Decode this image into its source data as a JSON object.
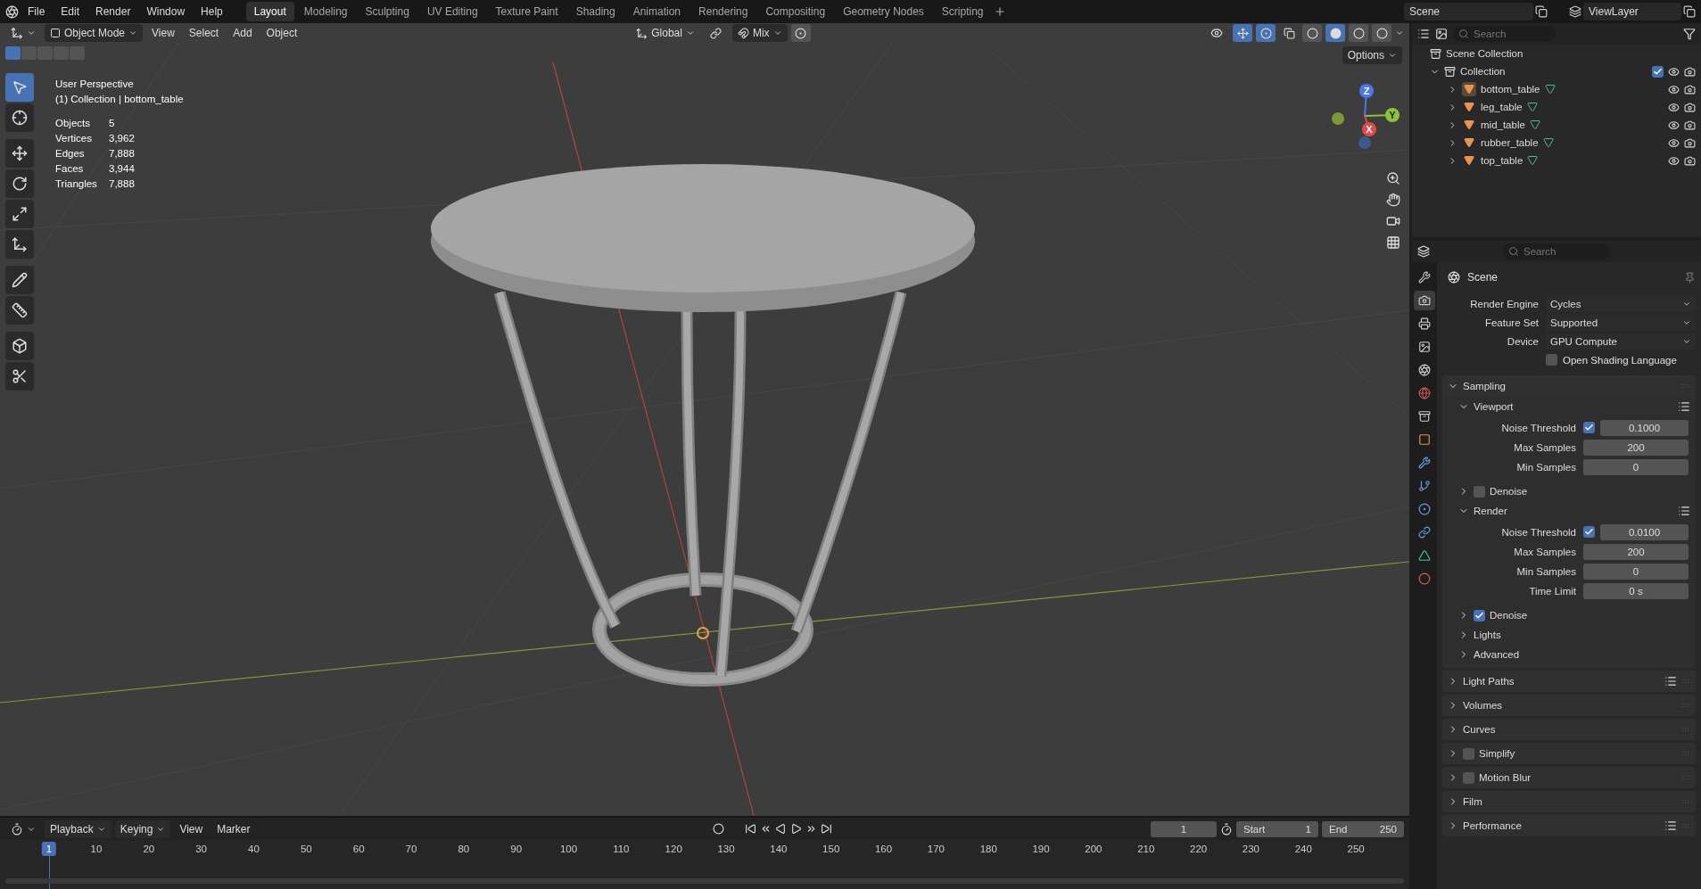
{
  "top_bar": {
    "menus": [
      "File",
      "Edit",
      "Render",
      "Window",
      "Help"
    ],
    "workspaces": [
      {
        "label": "Layout",
        "selected": true
      },
      {
        "label": "Modeling",
        "selected": false
      },
      {
        "label": "Sculpting",
        "selected": false
      },
      {
        "label": "UV Editing",
        "selected": false
      },
      {
        "label": "Texture Paint",
        "selected": false
      },
      {
        "label": "Shading",
        "selected": false
      },
      {
        "label": "Animation",
        "selected": false
      },
      {
        "label": "Rendering",
        "selected": false
      },
      {
        "label": "Compositing",
        "selected": false
      },
      {
        "label": "Geometry Nodes",
        "selected": false
      },
      {
        "label": "Scripting",
        "selected": false
      }
    ],
    "scene": "Scene",
    "view_layer": "ViewLayer"
  },
  "viewport": {
    "mode": "Object Mode",
    "menus": [
      "View",
      "Select",
      "Add",
      "Object"
    ],
    "orientation": "Global",
    "snap": "Mix",
    "options": "Options",
    "select_modes": [
      {
        "selected": true
      },
      {
        "selected": false
      },
      {
        "selected": false
      },
      {
        "selected": false
      },
      {
        "selected": false
      }
    ],
    "shading": [
      {
        "selected": false
      },
      {
        "selected": true
      },
      {
        "selected": false
      },
      {
        "selected": false
      }
    ],
    "title": "User Perspective",
    "subtitle": "(1) Collection | bottom_table",
    "stats": [
      {
        "label": "Objects",
        "value": "5"
      },
      {
        "label": "Vertices",
        "value": "3,962"
      },
      {
        "label": "Edges",
        "value": "7,888"
      },
      {
        "label": "Faces",
        "value": "3,944"
      },
      {
        "label": "Triangles",
        "value": "7,888"
      }
    ],
    "tools": [
      {
        "kind": "select",
        "selected": true
      },
      {
        "kind": "cursor",
        "selected": false
      },
      {
        "kind": "move",
        "selected": false
      },
      {
        "kind": "rotate",
        "selected": false
      },
      {
        "kind": "scale",
        "selected": false
      },
      {
        "kind": "transform",
        "selected": false
      },
      {
        "kind": "annotate",
        "selected": false
      },
      {
        "kind": "measure",
        "selected": false
      },
      {
        "kind": "add-cube",
        "selected": false
      },
      {
        "kind": "cut",
        "selected": false
      }
    ],
    "gizmo": {
      "x": "X",
      "y": "Y",
      "z": "Z"
    }
  },
  "outliner": {
    "search_placeholder": "Search",
    "root": "Scene Collection",
    "collection": {
      "label": "Collection",
      "expanded": true,
      "checked": true,
      "children": [
        {
          "label": "bottom_table",
          "selected": true
        },
        {
          "label": "leg_table",
          "selected": false
        },
        {
          "label": "mid_table",
          "selected": false
        },
        {
          "label": "rubber_table",
          "selected": false
        },
        {
          "label": "top_table",
          "selected": false
        }
      ]
    }
  },
  "properties": {
    "search_placeholder": "Search",
    "context": "Scene",
    "tabs": [
      {
        "kind": "tool",
        "selected": false
      },
      {
        "kind": "render",
        "selected": true
      },
      {
        "kind": "output",
        "selected": false
      },
      {
        "kind": "view-layer",
        "selected": false
      },
      {
        "kind": "scene",
        "selected": false
      },
      {
        "kind": "world",
        "selected": false
      },
      {
        "kind": "collection",
        "selected": false
      },
      {
        "kind": "object",
        "selected": false
      },
      {
        "kind": "modifiers",
        "selected": false
      },
      {
        "kind": "particles",
        "selected": false
      },
      {
        "kind": "physics",
        "selected": false
      },
      {
        "kind": "constraints",
        "selected": false
      },
      {
        "kind": "data",
        "selected": false
      },
      {
        "kind": "material",
        "selected": false
      }
    ],
    "fields": [
      {
        "label": "Render Engine",
        "value": "Cycles"
      },
      {
        "label": "Feature Set",
        "value": "Supported"
      },
      {
        "label": "Device",
        "value": "GPU Compute"
      }
    ],
    "osl": {
      "label": "Open Shading Language",
      "checked": false
    },
    "sections": [
      {
        "label": "Sampling",
        "expanded": true,
        "children": [
          {
            "label": "Viewport",
            "expanded": true,
            "presets": true,
            "rows": [
              {
                "kind": "toggle-number",
                "label": "Noise Threshold",
                "checked": true,
                "value": "0.1000"
              },
              {
                "kind": "number",
                "label": "Max Samples",
                "value": "200"
              },
              {
                "kind": "number",
                "label": "Min Samples",
                "value": "0"
              }
            ]
          },
          {
            "label": "Denoise",
            "expanded": false,
            "checked": false
          },
          {
            "label": "Render",
            "expanded": true,
            "presets": true,
            "rows": [
              {
                "kind": "toggle-number",
                "label": "Noise Threshold",
                "checked": true,
                "value": "0.0100"
              },
              {
                "kind": "number",
                "label": "Max Samples",
                "value": "200"
              },
              {
                "kind": "number",
                "label": "Min Samples",
                "value": "0"
              },
              {
                "kind": "number",
                "label": "Time Limit",
                "value": "0 s"
              }
            ]
          },
          {
            "label": "Denoise",
            "expanded": false,
            "checked": true
          },
          {
            "label": "Lights",
            "expanded": false
          },
          {
            "label": "Advanced",
            "expanded": false
          }
        ]
      },
      {
        "label": "Light Paths",
        "expanded": false,
        "presets": true
      },
      {
        "label": "Volumes",
        "expanded": false
      },
      {
        "label": "Curves",
        "expanded": false
      },
      {
        "label": "Simplify",
        "expanded": false,
        "checked": false
      },
      {
        "label": "Motion Blur",
        "expanded": false,
        "checked": false
      },
      {
        "label": "Film",
        "expanded": false
      },
      {
        "label": "Performance",
        "expanded": false,
        "presets": true
      }
    ]
  },
  "timeline": {
    "menus": [
      "Playback",
      "Keying",
      "View",
      "Marker"
    ],
    "current_frame": "1",
    "start_label": "Start",
    "start": "1",
    "end_label": "End",
    "end": "250",
    "playhead": "1",
    "ticks": [
      "10",
      "20",
      "30",
      "40",
      "50",
      "60",
      "70",
      "80",
      "90",
      "100",
      "110",
      "120",
      "130",
      "140",
      "150",
      "160",
      "170",
      "180",
      "190",
      "200",
      "210",
      "220",
      "230",
      "240",
      "250"
    ]
  }
}
